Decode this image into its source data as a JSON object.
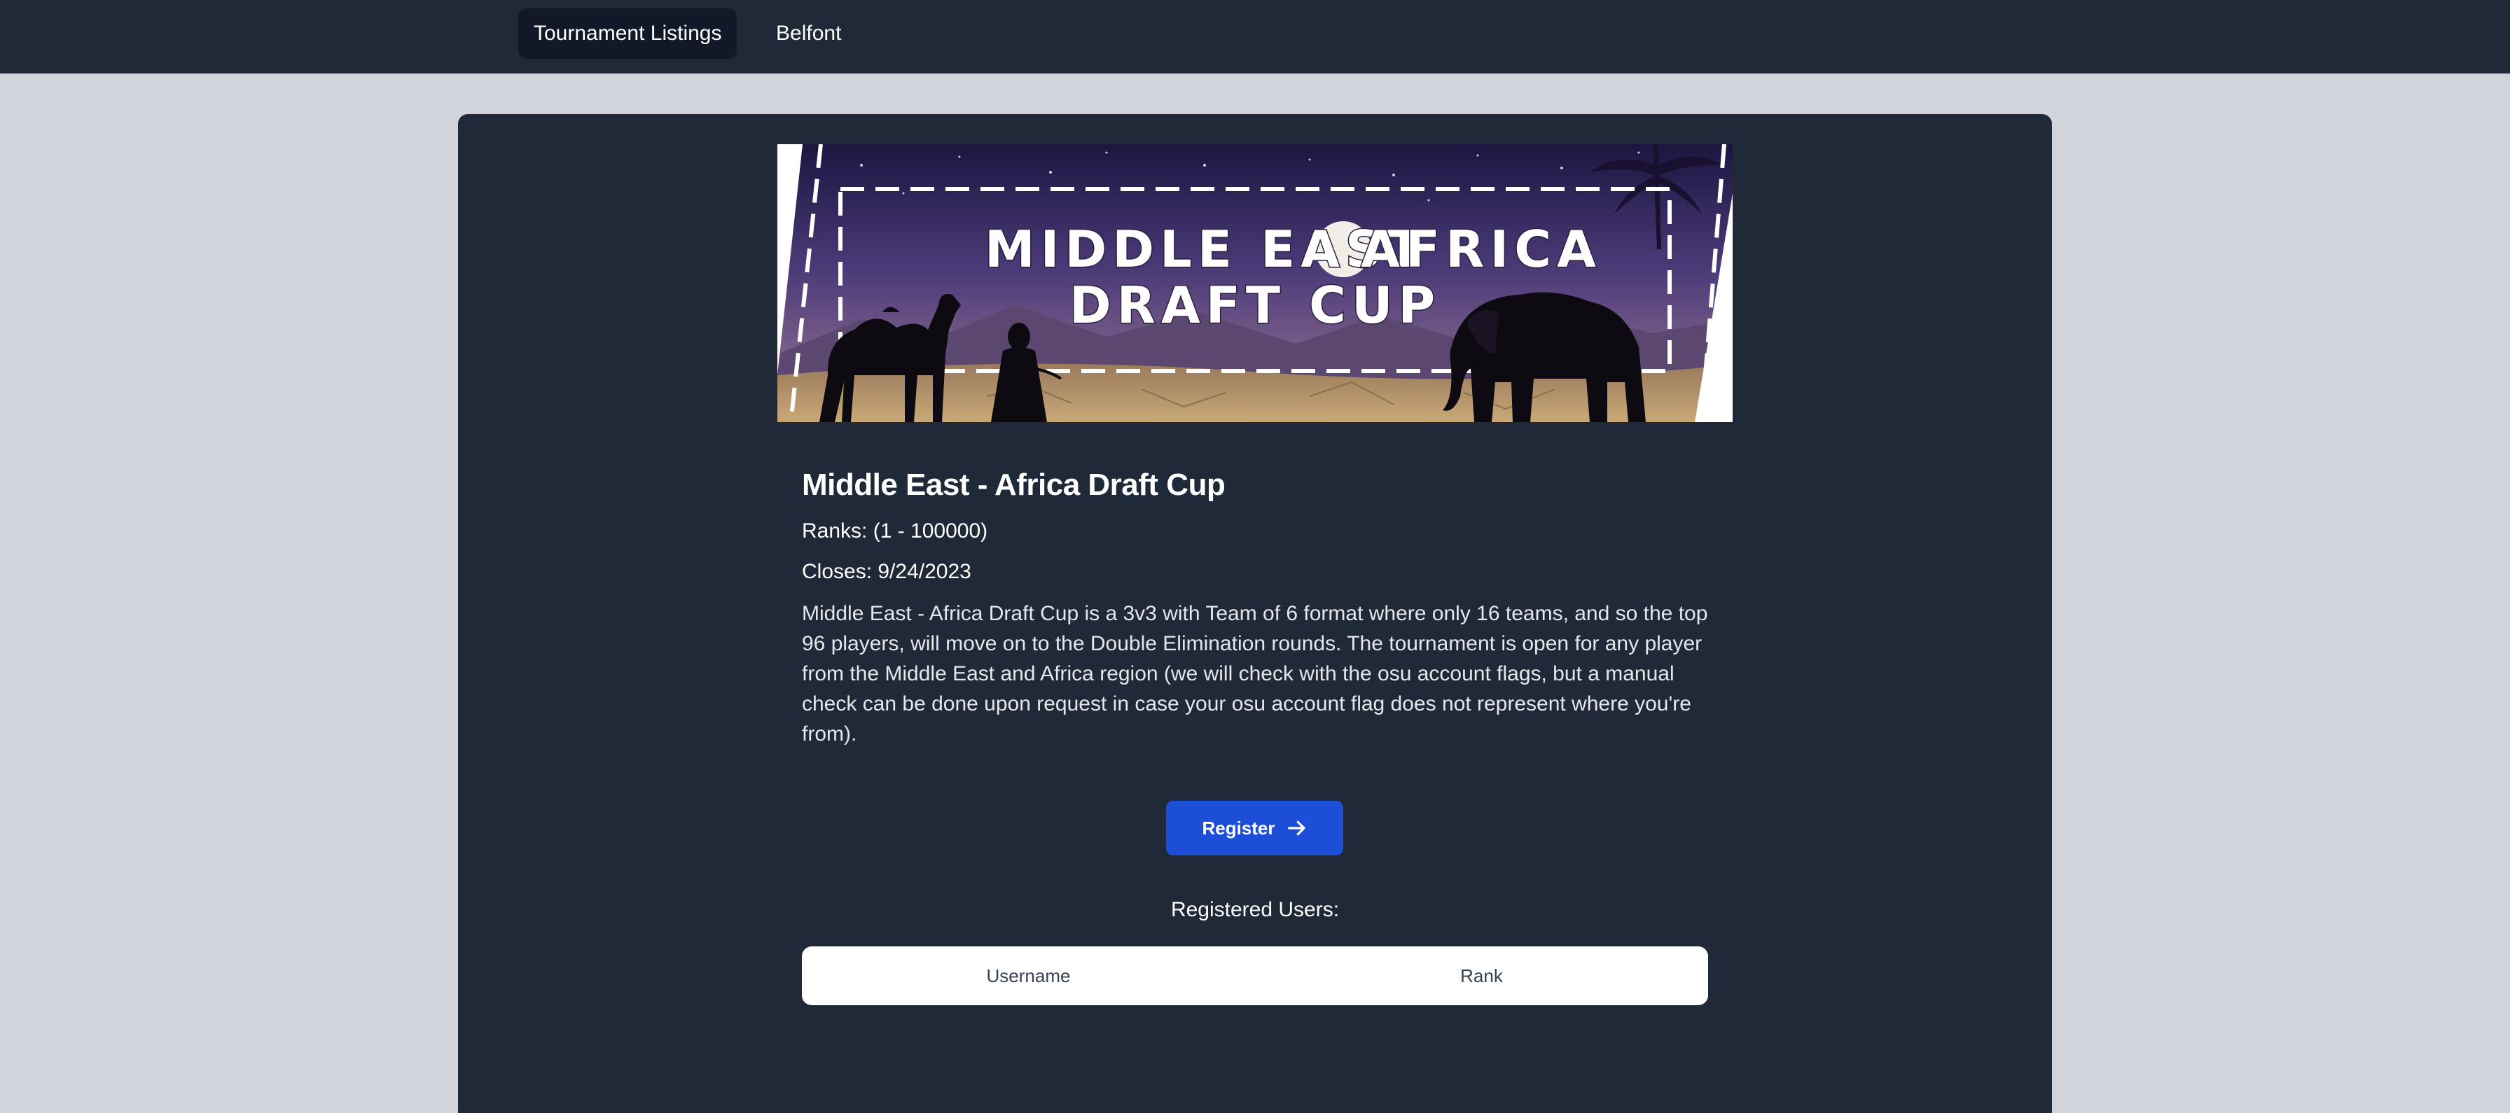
{
  "nav": {
    "items": [
      {
        "label": "Tournament Listings",
        "active": true
      },
      {
        "label": "Belfont",
        "active": false
      }
    ]
  },
  "banner": {
    "line1_left": "MIDDLE EAST",
    "line1_right": "AFRICA",
    "line2": "DRAFT CUP"
  },
  "tournament": {
    "title": "Middle East - Africa Draft Cup",
    "ranks": "Ranks: (1 - 100000)",
    "closes": "Closes: 9/24/2023",
    "description": "Middle East - Africa Draft Cup is a 3v3 with Team of 6 format where only 16 teams, and so the top 96 players, will move on to the Double Elimination rounds. The tournament is open for any player from the Middle East and Africa region (we will check with the osu account flags, but a manual check can be done upon request in case your osu account flag does not represent where you're from)."
  },
  "register": {
    "label": "Register",
    "icon": "arrow-right-icon"
  },
  "registered": {
    "heading": "Registered Users:",
    "columns": [
      "Username",
      "Rank"
    ],
    "rows": []
  },
  "colors": {
    "nav_bg": "#1f2937",
    "page_bg": "#d1d5db",
    "card_bg": "#1f2937",
    "button_bg": "#1d4ed8"
  }
}
